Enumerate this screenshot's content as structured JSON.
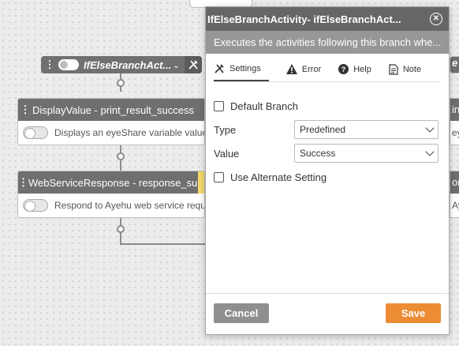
{
  "canvas": {
    "branch": {
      "label": "IfElseBranchAct..."
    },
    "cards": [
      {
        "title": "DisplayValue - print_result_success",
        "description": "Displays an eyeShare variable value"
      },
      {
        "title": "WebServiceResponse - response_su...",
        "description": "Respond to Ayehu web service requ"
      }
    ],
    "right_edge": {
      "branch_fragment": "e",
      "card1_head": "in",
      "card1_body": "ey",
      "card2_head": "on",
      "card2_body": "Ay"
    }
  },
  "dialog": {
    "title": "IfElseBranchActivity-  ifElseBranchAct...",
    "description": "Executes the activities following this branch whe...",
    "tabs": [
      {
        "label": "Settings",
        "icon": "tools-icon",
        "active": true
      },
      {
        "label": "Error",
        "icon": "warning-icon"
      },
      {
        "label": "Help",
        "icon": "help-icon"
      },
      {
        "label": "Note",
        "icon": "note-icon"
      }
    ],
    "form": {
      "default_branch_label": "Default Branch",
      "type_label": "Type",
      "type_value": "Predefined",
      "value_label": "Value",
      "value_value": "Success",
      "alternate_label": "Use Alternate Setting"
    },
    "buttons": {
      "cancel": "Cancel",
      "save": "Save"
    }
  },
  "colors": {
    "save": "#ec8d35",
    "cancel": "#8f8f8f",
    "title_bar": "#666666",
    "desc_bar": "#979797"
  }
}
